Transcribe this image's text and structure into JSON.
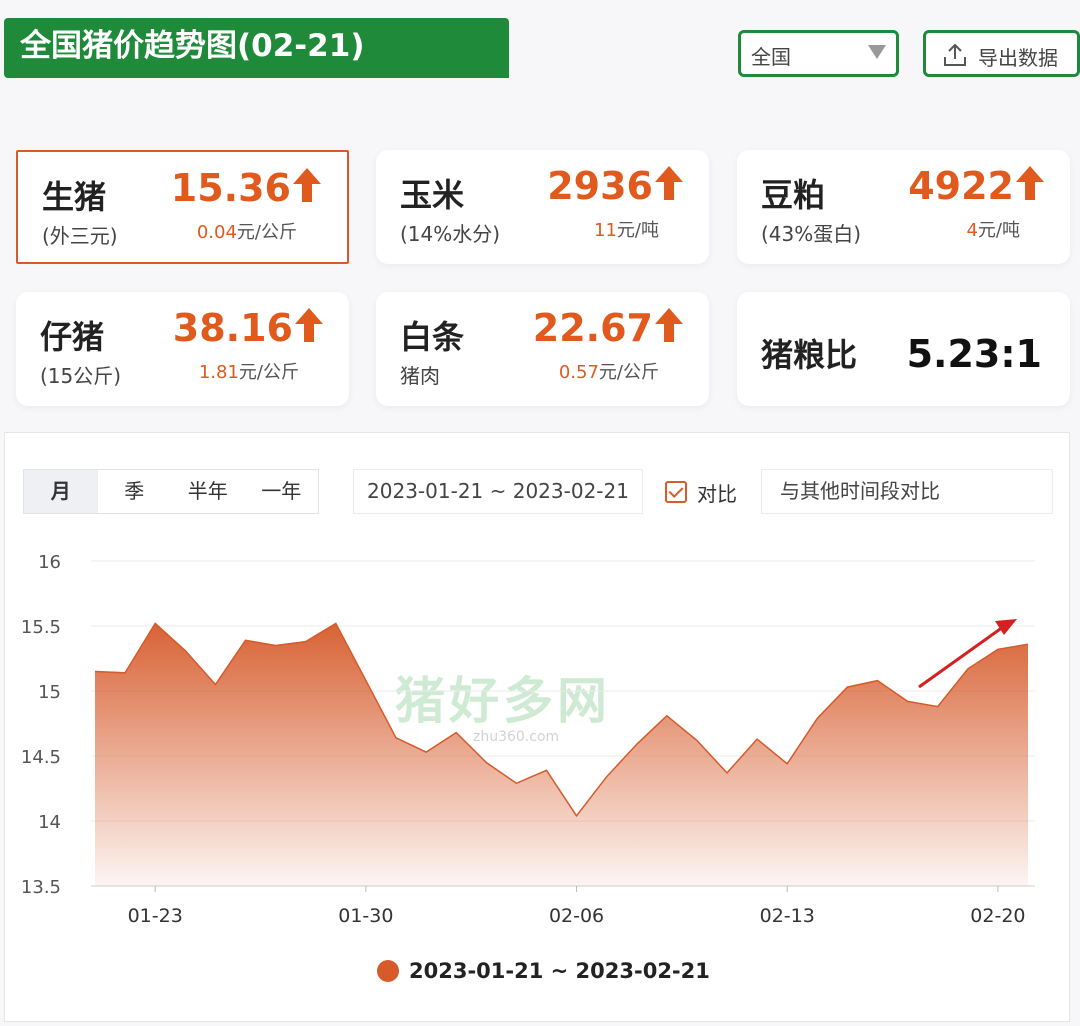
{
  "header": {
    "title": "全国猪价趋势图(02-21)",
    "region_value": "全国",
    "export_label": "导出数据"
  },
  "cards": [
    {
      "name": "生猪",
      "sub": "(外三元)",
      "price": "15.36",
      "change_num": "0.04",
      "change_unit": "元/公斤",
      "trend": "up"
    },
    {
      "name": "玉米",
      "sub": "(14%水分)",
      "price": "2936",
      "change_num": "11",
      "change_unit": "元/吨",
      "trend": "up"
    },
    {
      "name": "豆粕",
      "sub": "(43%蛋白)",
      "price": "4922",
      "change_num": "4",
      "change_unit": "元/吨",
      "trend": "up"
    },
    {
      "name": "仔猪",
      "sub": "(15公斤)",
      "price": "38.16",
      "change_num": "1.81",
      "change_unit": "元/公斤",
      "trend": "up"
    },
    {
      "name": "白条",
      "sub": "猪肉",
      "price": "22.67",
      "change_num": "0.57",
      "change_unit": "元/公斤",
      "trend": "up"
    },
    {
      "name": "猪粮比",
      "ratio": "5.23:1"
    }
  ],
  "controls": {
    "tabs": [
      "月",
      "季",
      "半年",
      "一年"
    ],
    "active_tab": "月",
    "date_range": "2023-01-21 ~ 2023-02-21",
    "compare_label": "对比",
    "compare_placeholder": "与其他时间段对比"
  },
  "watermark": {
    "main": "猪好多网",
    "sub": "zhu360.com"
  },
  "colors": {
    "brand_green": "#1e8a3a",
    "accent_orange": "#e05a1e",
    "series": "#d65a2a"
  },
  "chart_data": {
    "type": "area",
    "title": "",
    "xlabel": "",
    "ylabel": "",
    "ylim": [
      13.5,
      16
    ],
    "yticks": [
      16,
      15.5,
      15,
      14.5,
      14,
      13.5
    ],
    "grid": true,
    "legend_position": "bottom",
    "x_tick_labels": [
      "01-23",
      "01-30",
      "02-06",
      "02-13",
      "02-20"
    ],
    "x": [
      "01-21",
      "01-22",
      "01-23",
      "01-24",
      "01-25",
      "01-26",
      "01-27",
      "01-28",
      "01-29",
      "01-30",
      "01-31",
      "02-01",
      "02-02",
      "02-03",
      "02-04",
      "02-05",
      "02-06",
      "02-07",
      "02-08",
      "02-09",
      "02-10",
      "02-11",
      "02-12",
      "02-13",
      "02-14",
      "02-15",
      "02-16",
      "02-17",
      "02-18",
      "02-19",
      "02-20",
      "02-21"
    ],
    "series": [
      {
        "name": "2023-01-21 ~ 2023-02-21",
        "values": [
          15.15,
          15.14,
          15.52,
          15.31,
          15.05,
          15.39,
          15.35,
          15.38,
          15.52,
          15.08,
          14.64,
          14.53,
          14.68,
          14.45,
          14.29,
          14.39,
          14.04,
          14.34,
          14.59,
          14.81,
          14.62,
          14.37,
          14.63,
          14.44,
          14.79,
          15.03,
          15.08,
          14.92,
          14.88,
          15.17,
          15.32,
          15.36
        ]
      }
    ],
    "annotation": "up-trend-arrow"
  }
}
